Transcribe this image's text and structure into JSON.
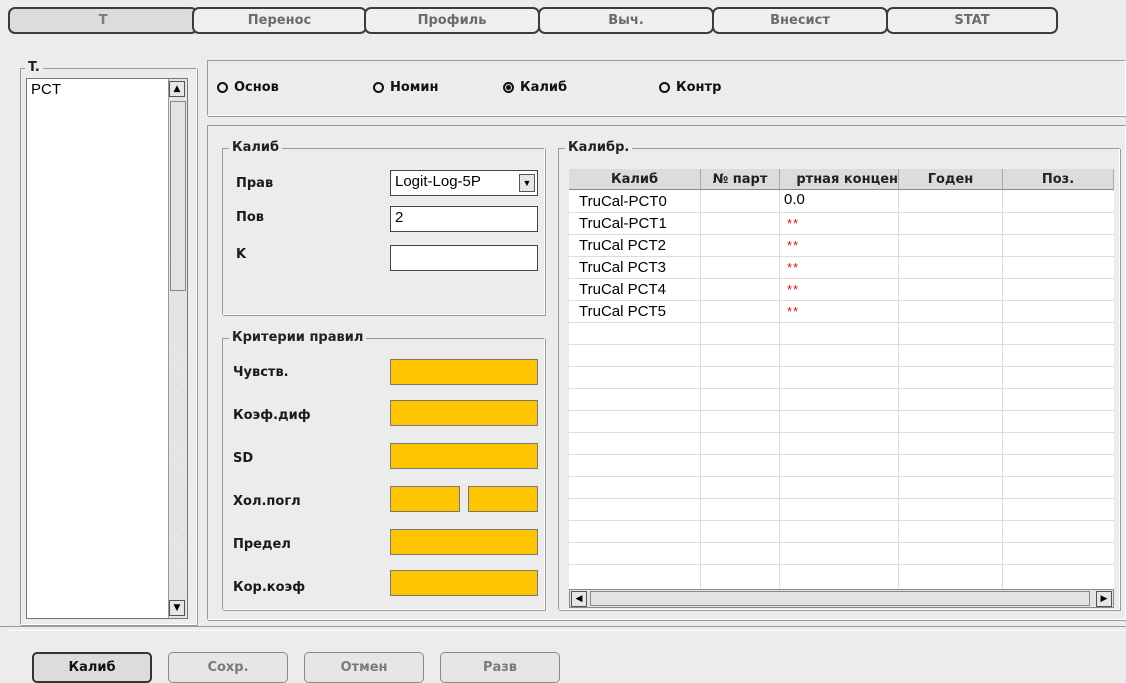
{
  "top_tabs": [
    "T",
    "Перенос",
    "Профиль",
    "Выч.",
    "Внесист",
    "STAT"
  ],
  "left_panel": {
    "title": "T.",
    "items": [
      "PCT"
    ]
  },
  "radio_group": {
    "options": [
      "Основ",
      "Номин",
      "Калиб",
      "Контр"
    ],
    "selected": "Калиб"
  },
  "calib_group": {
    "title": "Калиб",
    "rule_label": "Прав",
    "rule_value": "Logit-Log-5P",
    "repeat_label": "Пов",
    "repeat_value": "2",
    "k_label": "K",
    "k_value": ""
  },
  "criteria_group": {
    "title": "Критерии правил",
    "rows": [
      "Чувств.",
      "Коэф.диф",
      "SD",
      "Хол.погл",
      "Предел",
      "Кор.коэф"
    ]
  },
  "calibrators": {
    "title": "Калибр.",
    "columns": [
      "Калиб",
      "№ парт",
      "ртная концен",
      "Годен",
      "Поз."
    ],
    "rows": [
      {
        "name": "TruCal-PCT0",
        "lot": "",
        "conc": "0.0",
        "valid": "",
        "pos": ""
      },
      {
        "name": "TruCal-PCT1",
        "lot": "",
        "conc": "**",
        "valid": "",
        "pos": ""
      },
      {
        "name": "TruCal PCT2",
        "lot": "",
        "conc": "**",
        "valid": "",
        "pos": ""
      },
      {
        "name": "TruCal PCT3",
        "lot": "",
        "conc": "**",
        "valid": "",
        "pos": ""
      },
      {
        "name": "TruCal PCT4",
        "lot": "",
        "conc": "**",
        "valid": "",
        "pos": ""
      },
      {
        "name": "TruCal PCT5",
        "lot": "",
        "conc": "**",
        "valid": "",
        "pos": ""
      }
    ]
  },
  "bottom_buttons": [
    "Калиб",
    "Сохр.",
    "Отмен",
    "Разв"
  ],
  "colors": {
    "criteria_field": "#ffc400",
    "required_mark": "#dd1111"
  },
  "icons": [
    "scroll-up-icon",
    "scroll-down-icon",
    "scroll-left-icon",
    "scroll-right-icon",
    "dropdown-arrow-icon"
  ]
}
